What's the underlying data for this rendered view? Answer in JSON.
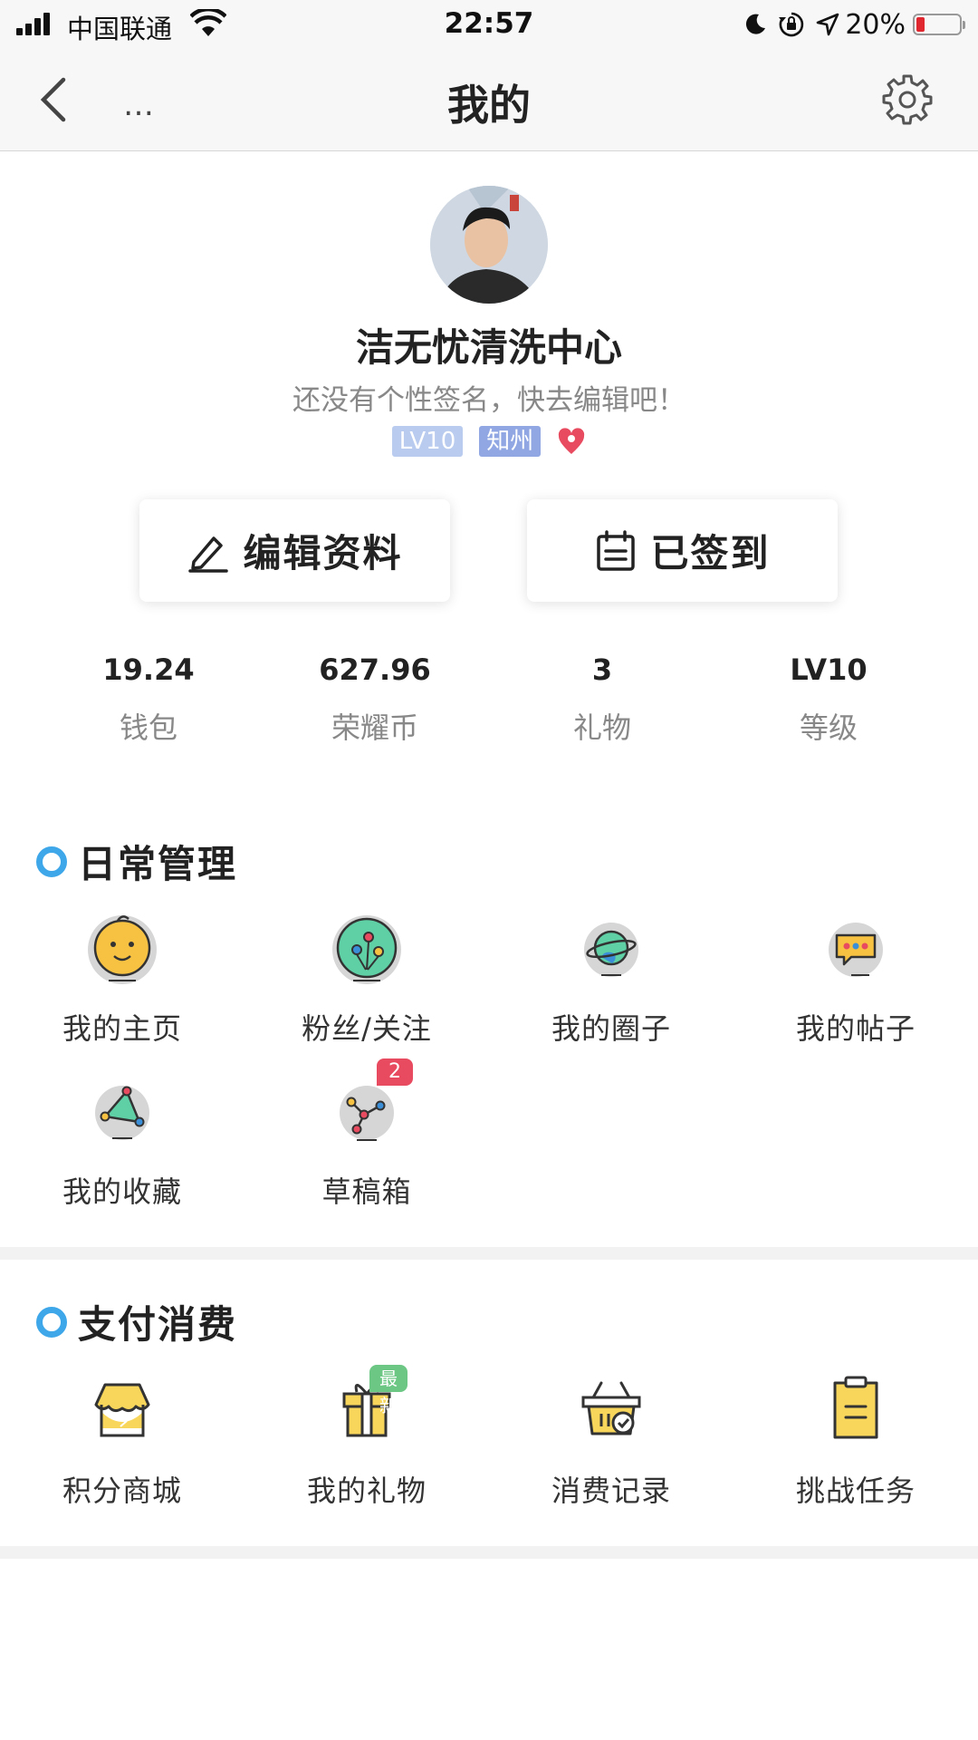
{
  "status_bar": {
    "carrier": "中国联通",
    "time": "22:57",
    "battery": "20%",
    "battery_level": 0.2
  },
  "nav": {
    "back_more": "…",
    "title": "我的"
  },
  "profile": {
    "name": "洁无忧清洗中心",
    "signature": "还没有个性签名，快去编辑吧！",
    "level_badge": "LV10",
    "city_badge": "知州"
  },
  "actions": {
    "edit": "编辑资料",
    "checkin": "已签到"
  },
  "stats": [
    {
      "value": "19.24",
      "label": "钱包"
    },
    {
      "value": "627.96",
      "label": "荣耀币"
    },
    {
      "value": "3",
      "label": "礼物"
    },
    {
      "value": "LV10",
      "label": "等级"
    }
  ],
  "daily": {
    "title": "日常管理",
    "items": [
      {
        "label": "我的主页",
        "icon": "baby-face-icon"
      },
      {
        "label": "粉丝/关注",
        "icon": "balloons-icon"
      },
      {
        "label": "我的圈子",
        "icon": "planet-icon"
      },
      {
        "label": "我的帖子",
        "icon": "chat-bubble-icon"
      },
      {
        "label": "我的收藏",
        "icon": "triangle-nodes-icon"
      },
      {
        "label": "草稿箱",
        "icon": "draft-nodes-icon",
        "badge": "2"
      }
    ]
  },
  "pay": {
    "title": "支付消费",
    "items": [
      {
        "label": "积分商城",
        "icon": "shop-icon"
      },
      {
        "label": "我的礼物",
        "icon": "gift-box-icon",
        "badge": "最新"
      },
      {
        "label": "消费记录",
        "icon": "basket-icon"
      },
      {
        "label": "挑战任务",
        "icon": "clipboard-icon"
      }
    ]
  },
  "colors": {
    "accent_blue": "#3ea7e9",
    "icon_yellow": "#f7d65b",
    "badge_red": "#e84a5f",
    "badge_green": "#6cc785"
  }
}
